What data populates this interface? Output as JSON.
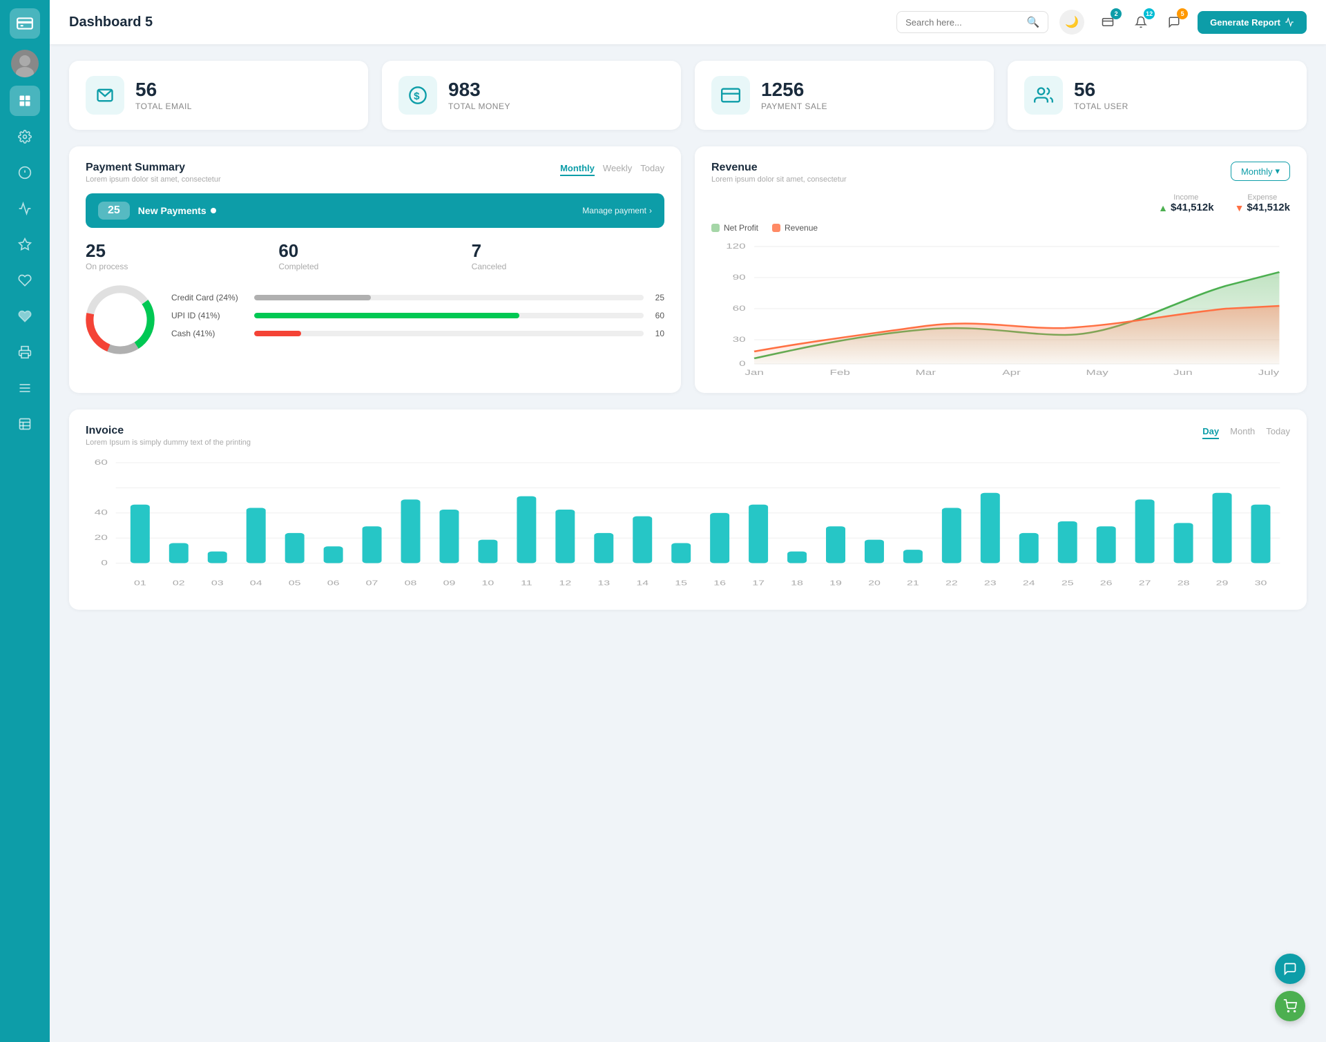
{
  "sidebar": {
    "logo_icon": "wallet",
    "items": [
      {
        "id": "avatar",
        "icon": "👤",
        "active": false
      },
      {
        "id": "dashboard",
        "icon": "⊞",
        "active": true
      },
      {
        "id": "settings",
        "icon": "⚙",
        "active": false
      },
      {
        "id": "info",
        "icon": "ℹ",
        "active": false
      },
      {
        "id": "chart",
        "icon": "📊",
        "active": false
      },
      {
        "id": "star",
        "icon": "★",
        "active": false
      },
      {
        "id": "heart",
        "icon": "♥",
        "active": false
      },
      {
        "id": "heart2",
        "icon": "♥",
        "active": false
      },
      {
        "id": "print",
        "icon": "🖨",
        "active": false
      },
      {
        "id": "menu",
        "icon": "☰",
        "active": false
      },
      {
        "id": "list",
        "icon": "📋",
        "active": false
      }
    ]
  },
  "header": {
    "title": "Dashboard 5",
    "search_placeholder": "Search here...",
    "badges": {
      "wallet": "2",
      "bell": "12",
      "chat": "5"
    },
    "generate_btn": "Generate Report"
  },
  "stats": [
    {
      "id": "email",
      "number": "56",
      "label": "TOTAL EMAIL",
      "icon": "📋"
    },
    {
      "id": "money",
      "number": "983",
      "label": "TOTAL MONEY",
      "icon": "$"
    },
    {
      "id": "payment",
      "number": "1256",
      "label": "PAYMENT SALE",
      "icon": "💳"
    },
    {
      "id": "user",
      "number": "56",
      "label": "TOTAL USER",
      "icon": "👥"
    }
  ],
  "payment_summary": {
    "title": "Payment Summary",
    "subtitle": "Lorem ipsum dolor sit amet, consectetur",
    "tabs": [
      "Monthly",
      "Weekly",
      "Today"
    ],
    "active_tab": "Monthly",
    "new_payments_count": "25",
    "new_payments_label": "New Payments",
    "manage_link": "Manage payment",
    "metrics": [
      {
        "number": "25",
        "label": "On process"
      },
      {
        "number": "60",
        "label": "Completed"
      },
      {
        "number": "7",
        "label": "Canceled"
      }
    ],
    "payment_bars": [
      {
        "label": "Credit Card (24%)",
        "color": "#b0b0b0",
        "width": 30,
        "count": "25"
      },
      {
        "label": "UPI ID (41%)",
        "color": "#00c853",
        "width": 68,
        "count": "60"
      },
      {
        "label": "Cash (41%)",
        "color": "#f44336",
        "width": 12,
        "count": "10"
      }
    ],
    "donut": {
      "segments": [
        {
          "color": "#b0b0b0",
          "pct": 24
        },
        {
          "color": "#00c853",
          "pct": 41
        },
        {
          "color": "#f44336",
          "pct": 35
        }
      ]
    }
  },
  "revenue": {
    "title": "Revenue",
    "subtitle": "Lorem ipsum dolor sit amet, consectetur",
    "active_tab": "Monthly",
    "income_label": "Income",
    "income_value": "$41,512k",
    "expense_label": "Expense",
    "expense_value": "$41,512k",
    "legend": [
      {
        "label": "Net Profit",
        "color": "#a5d6a7"
      },
      {
        "label": "Revenue",
        "color": "#ff8a65"
      }
    ],
    "x_labels": [
      "Jan",
      "Feb",
      "Mar",
      "Apr",
      "May",
      "Jun",
      "July"
    ],
    "y_labels": [
      "0",
      "30",
      "60",
      "90",
      "120"
    ],
    "net_profit_data": [
      5,
      25,
      28,
      35,
      30,
      80,
      95
    ],
    "revenue_data": [
      10,
      35,
      32,
      42,
      38,
      48,
      55
    ]
  },
  "invoice": {
    "title": "Invoice",
    "subtitle": "Lorem Ipsum is simply dummy text of the printing",
    "tabs": [
      "Day",
      "Month",
      "Today"
    ],
    "active_tab": "Day",
    "y_labels": [
      "0",
      "20",
      "40",
      "60"
    ],
    "x_labels": [
      "01",
      "02",
      "03",
      "04",
      "05",
      "06",
      "07",
      "08",
      "09",
      "10",
      "11",
      "12",
      "13",
      "14",
      "15",
      "16",
      "17",
      "18",
      "19",
      "20",
      "21",
      "22",
      "23",
      "24",
      "25",
      "26",
      "27",
      "28",
      "29",
      "30"
    ],
    "bar_data": [
      35,
      12,
      7,
      33,
      18,
      10,
      22,
      38,
      32,
      14,
      40,
      32,
      18,
      28,
      12,
      30,
      35,
      7,
      22,
      14,
      8,
      33,
      42,
      18,
      25,
      22,
      38,
      24,
      42,
      35
    ]
  },
  "fabs": [
    {
      "id": "support",
      "icon": "💬",
      "color": "teal"
    },
    {
      "id": "cart",
      "icon": "🛒",
      "color": "green"
    }
  ]
}
